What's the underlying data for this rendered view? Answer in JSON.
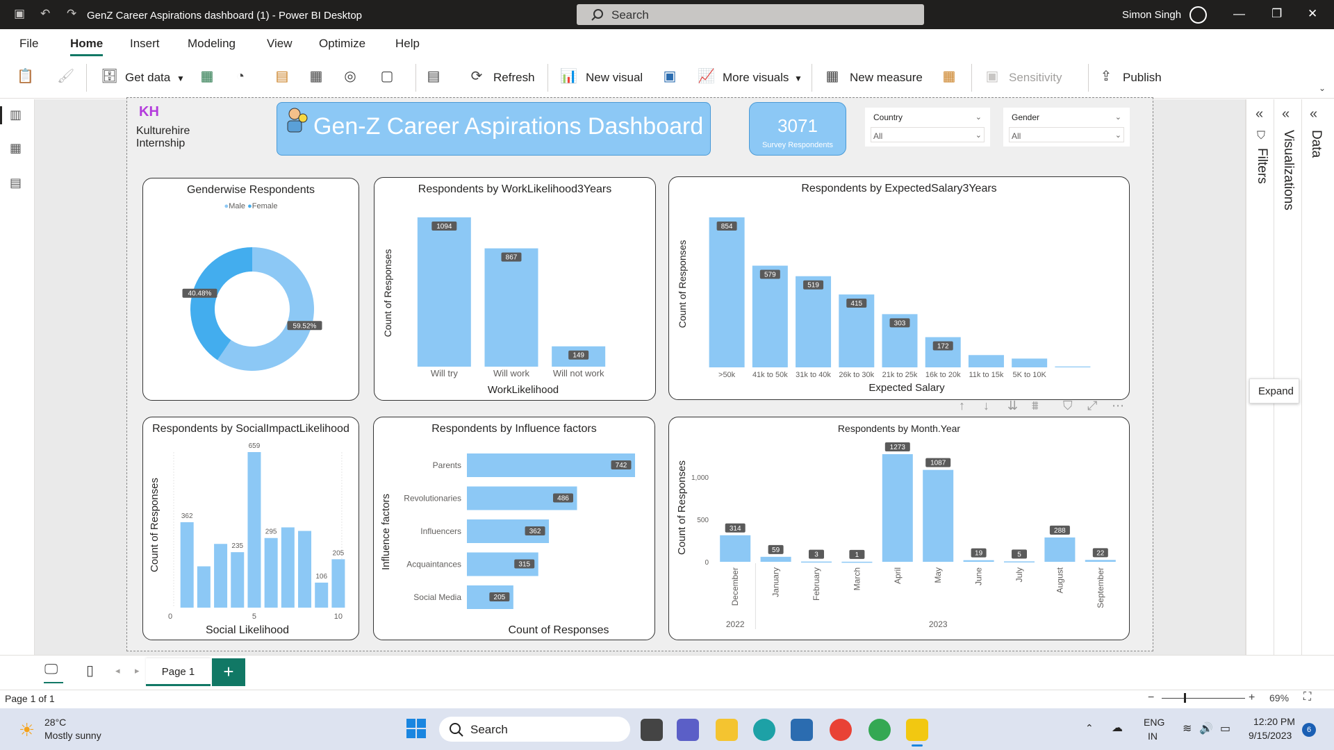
{
  "titlebar": {
    "title": "GenZ Career Aspirations dashboard (1) - Power BI Desktop",
    "search_placeholder": "Search",
    "user": "Simon Singh"
  },
  "menu": [
    "File",
    "Home",
    "Insert",
    "Modeling",
    "View",
    "Optimize",
    "Help"
  ],
  "ribbon": {
    "get_data": "Get data",
    "refresh": "Refresh",
    "new_visual": "New visual",
    "more_visuals": "More visuals",
    "new_measure": "New measure",
    "sensitivity": "Sensitivity",
    "publish": "Publish"
  },
  "report": {
    "brand_line1": "Kulturehire",
    "brand_line2": "Internship",
    "title": "Gen-Z Career Aspirations Dashboard",
    "kpi_value": "3071",
    "kpi_label": "Survey Respondents",
    "slicer_country_label": "Country",
    "slicer_country_value": "All",
    "slicer_gender_label": "Gender",
    "slicer_gender_value": "All"
  },
  "colors": {
    "bar": "#8cc8f5",
    "bar_dark": "#43adee",
    "accent": "#117865",
    "label_bg": "#5a5a5a"
  },
  "chart_data": [
    {
      "type": "pie",
      "title": "Genderwise Respondents",
      "legend": [
        "Male",
        "Female"
      ],
      "categories": [
        "Male",
        "Female"
      ],
      "values": [
        59.52,
        40.48
      ],
      "labels": [
        "59.52%",
        "40.48%"
      ],
      "legend_position": "top"
    },
    {
      "type": "bar",
      "title": "Respondents by WorkLikelihood3Years",
      "categories": [
        "Will try",
        "Will work",
        "Will not work"
      ],
      "values": [
        1094,
        867,
        149
      ],
      "xlabel": "WorkLikelihood",
      "ylabel": "Count of Responses",
      "ylim": [
        0,
        1094
      ]
    },
    {
      "type": "bar",
      "title": "Respondents by ExpectedSalary3Years",
      "categories": [
        ">50k",
        "41k to 50k",
        "31k to 40k",
        "26k to 30k",
        "21k to 25k",
        "16k to 20k",
        "11k to 15k",
        "5K to 10K",
        ""
      ],
      "values": [
        854,
        579,
        519,
        415,
        303,
        172,
        70,
        50,
        5
      ],
      "value_labels": [
        "854",
        "579",
        "519",
        "415",
        "303",
        "172",
        "",
        "",
        ""
      ],
      "xlabel": "Expected Salary",
      "ylabel": "Count of Responses",
      "ylim": [
        0,
        854
      ]
    },
    {
      "type": "bar",
      "title": "Respondents by SocialImpactLikelihood",
      "x": [
        1,
        2,
        3,
        4,
        5,
        6,
        7,
        8,
        9,
        10
      ],
      "values": [
        362,
        175,
        270,
        235,
        659,
        295,
        340,
        325,
        106,
        205
      ],
      "value_labels": [
        "362",
        "",
        "",
        "235",
        "659",
        "295",
        "",
        "",
        "106",
        "205"
      ],
      "x_ticks": [
        "0",
        "5",
        "10"
      ],
      "xlim": [
        0,
        10
      ],
      "ylim": [
        0,
        659
      ],
      "xlabel": "Social Likelihood",
      "ylabel": "Count of Responses"
    },
    {
      "type": "bar",
      "orientation": "horizontal",
      "title": "Respondents by Influence factors",
      "categories": [
        "Parents",
        "Revolutionaries",
        "Influencers",
        "Acquaintances",
        "Social Media"
      ],
      "values": [
        742,
        486,
        362,
        315,
        205
      ],
      "xlabel": "Count of Responses",
      "ylabel": "Influence factors",
      "xlim": [
        0,
        742
      ]
    },
    {
      "type": "bar",
      "title": "Respondents by Month.Year",
      "categories": [
        "December",
        "January",
        "February",
        "March",
        "April",
        "May",
        "June",
        "July",
        "August",
        "September"
      ],
      "groups": [
        {
          "label": "2022",
          "count": 1
        },
        {
          "label": "2023",
          "count": 9
        }
      ],
      "values": [
        314,
        59,
        3,
        1,
        1273,
        1087,
        19,
        5,
        288,
        22
      ],
      "y_ticks": [
        "0",
        "500",
        "1,000"
      ],
      "ylim": [
        0,
        1273
      ],
      "ylabel": "Count of Responses"
    }
  ],
  "right_panes": {
    "filters": "Filters",
    "visualizations": "Visualizations",
    "data": "Data",
    "expand_tooltip": "Expand"
  },
  "pagebar": {
    "page_tab": "Page 1"
  },
  "status": {
    "page": "Page 1 of 1",
    "zoom": "69%"
  },
  "taskbar": {
    "weather_temp": "28°C",
    "weather_text": "Mostly sunny",
    "search": "Search",
    "lang1": "ENG",
    "lang2": "IN",
    "time": "12:20 PM",
    "date": "9/15/2023",
    "notif": "6"
  }
}
